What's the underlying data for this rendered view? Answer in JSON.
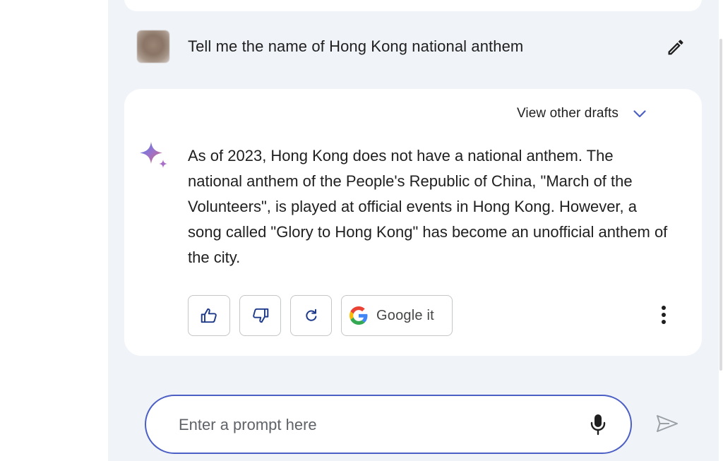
{
  "conversation": {
    "user_prompt": "Tell me the name of Hong Kong national anthem",
    "drafts_label": "View other drafts",
    "answer": "As of 2023, Hong Kong does not have a national anthem. The national anthem of the People's Republic of China, \"March of the Volunteers\", is played at official events in Hong Kong. However, a song called \"Glory to Hong Kong\" has become an unofficial anthem of the city."
  },
  "actions": {
    "google_label": "Google it",
    "icons": [
      "thumbs-up-icon",
      "thumbs-down-icon",
      "regenerate-icon",
      "google-g-icon",
      "more-vert-icon"
    ]
  },
  "prompt_bar": {
    "placeholder": "Enter a prompt here",
    "value": "",
    "icons": [
      "mic-icon",
      "send-icon"
    ]
  },
  "colors": {
    "accent": "#4b5fc4",
    "page_background": "#f0f4f9",
    "card_background": "#ffffff",
    "text": "#1f1f1f",
    "muted_icon": "#9aa0a6"
  }
}
